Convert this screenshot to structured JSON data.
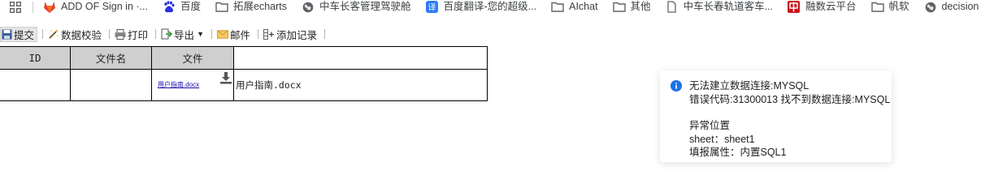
{
  "bookmarks": [
    {
      "label": "ADD OF Sign in ·...",
      "icon": "gitlab-icon"
    },
    {
      "label": "百度",
      "icon": "baidu-paw-icon"
    },
    {
      "label": "拓展echarts",
      "icon": "folder-icon"
    },
    {
      "label": "中车长客管理驾驶舱",
      "icon": "globe-icon"
    },
    {
      "label": "百度翻译-您的超级...",
      "icon": "translate-icon"
    },
    {
      "label": "AIchat",
      "icon": "folder-icon"
    },
    {
      "label": "其他",
      "icon": "folder-icon"
    },
    {
      "label": "中车长春轨道客车...",
      "icon": "page-icon"
    },
    {
      "label": "融数云平台",
      "icon": "crrc-logo-icon"
    },
    {
      "label": "帆软",
      "icon": "folder-icon"
    },
    {
      "label": "decision",
      "icon": "globe-icon"
    }
  ],
  "toolbar": {
    "submit": "提交",
    "validate": "数据校验",
    "print": "打印",
    "export": "导出",
    "mail": "邮件",
    "add_record": "添加记录"
  },
  "table": {
    "headers": [
      "ID",
      "文件名",
      "文件",
      ""
    ],
    "row": {
      "id": "",
      "filename": "",
      "file_link": "用户指南.docx",
      "extra": "用户指南.docx"
    }
  },
  "notification": {
    "title": "无法建立数据连接:MYSQL",
    "error_code": "错误代码:31300013 找不到数据连接:MYSQL",
    "location_label": "异常位置",
    "sheet": "sheet：sheet1",
    "fill_attr": "填报属性：内置SQL1"
  },
  "colors": {
    "header_bg": "#cfcfcf",
    "link": "#1a0dab",
    "info_icon": "#1a73e8",
    "gitlab": "#e24329",
    "baidu": "#2932e1",
    "translate": "#2f7cf6",
    "crrc": "#c8161d"
  }
}
